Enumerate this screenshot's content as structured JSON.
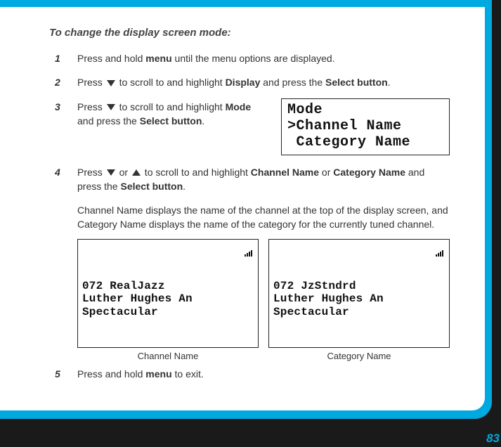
{
  "heading": "To change the display screen mode:",
  "steps": {
    "n1": "1",
    "s1_a": "Press and hold ",
    "s1_b": "menu",
    "s1_c": " until the menu options are displayed.",
    "n2": "2",
    "s2_a": "Press ",
    "s2_b": " to scroll to and highlight ",
    "s2_c": "Display",
    "s2_d": " and press the ",
    "s2_e": "Select button",
    "s2_f": ".",
    "n3": "3",
    "s3_a": "Press ",
    "s3_b": " to scroll to and highlight ",
    "s3_c": "Mode",
    "s3_d": " and press the ",
    "s3_e": "Select button",
    "s3_f": ".",
    "n4": "4",
    "s4_a": "Press ",
    "s4_b": " or ",
    "s4_c": " to scroll to and highlight ",
    "s4_d": "Channel Name",
    "s4_e": " or ",
    "s4_f": "Category Name",
    "s4_g": " and press the ",
    "s4_h": "Select button",
    "s4_i": ".",
    "n5": "5",
    "s5_a": "Press and hold ",
    "s5_b": "menu",
    "s5_c": " to exit."
  },
  "mode_lcd": {
    "l1": "Mode",
    "l2": ">Channel Name",
    "l3": " Category Name"
  },
  "explain": "Channel Name displays the name of the channel at the top of the display screen, and Category Name displays the name of the category for the currently tuned channel.",
  "example_left": {
    "r1": "072 RealJazz",
    "r2": "Luther Hughes An",
    "r3": "Spectacular",
    "caption": "Channel Name"
  },
  "example_right": {
    "r1": "072 JzStndrd",
    "r2": "Luther Hughes An",
    "r3": "Spectacular",
    "caption": "Category Name"
  },
  "page_number": "83"
}
